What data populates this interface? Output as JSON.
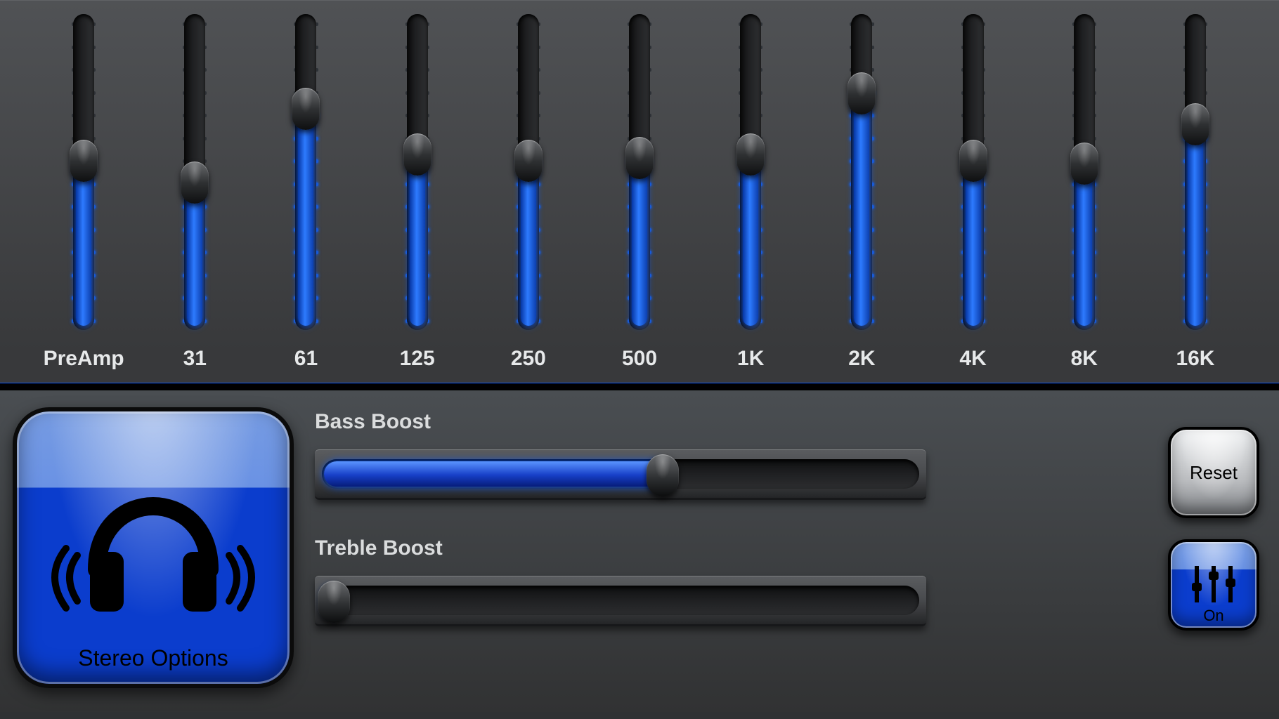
{
  "eq": {
    "bands": [
      {
        "label": "PreAmp",
        "value": 55
      },
      {
        "label": "31",
        "value": 48
      },
      {
        "label": "61",
        "value": 72
      },
      {
        "label": "125",
        "value": 57
      },
      {
        "label": "250",
        "value": 55
      },
      {
        "label": "500",
        "value": 56
      },
      {
        "label": "1K",
        "value": 57
      },
      {
        "label": "2K",
        "value": 77
      },
      {
        "label": "4K",
        "value": 55
      },
      {
        "label": "8K",
        "value": 54
      },
      {
        "label": "16K",
        "value": 67
      }
    ]
  },
  "boosts": {
    "bass": {
      "label": "Bass Boost",
      "value": 57
    },
    "treble": {
      "label": "Treble Boost",
      "value": 2
    }
  },
  "buttons": {
    "stereo_label": "Stereo Options",
    "reset_label": "Reset",
    "on_label": "On"
  },
  "colors": {
    "accent": "#0b3dcd",
    "glow": "#0b59ff"
  }
}
